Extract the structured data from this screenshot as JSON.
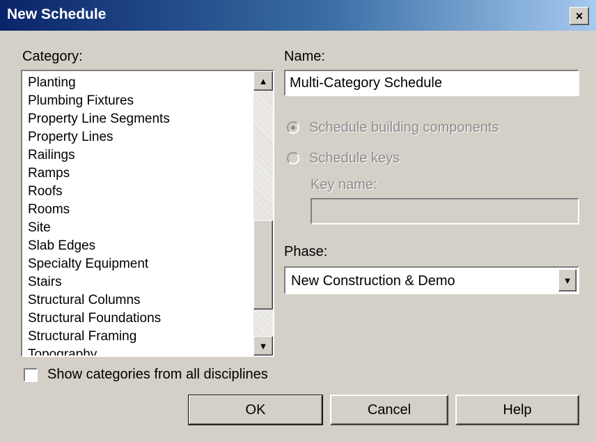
{
  "window": {
    "title": "New Schedule",
    "close_glyph": "×",
    "icon": "close-icon"
  },
  "category": {
    "label": "Category:",
    "items": [
      "Planting",
      "Plumbing Fixtures",
      "Property Line Segments",
      "Property Lines",
      "Railings",
      "Ramps",
      "Roofs",
      "Rooms",
      "Site",
      "Slab Edges",
      "Specialty Equipment",
      "Stairs",
      "Structural Columns",
      "Structural Foundations",
      "Structural Framing",
      "Topography"
    ],
    "scroll_up_glyph": "▲",
    "scroll_down_glyph": "▼"
  },
  "name": {
    "label": "Name:",
    "value": "Multi-Category Schedule"
  },
  "schedule_type": {
    "components_label": "Schedule building components",
    "keys_label": "Schedule keys",
    "key_name_label": "Key name:",
    "key_name_value": "",
    "selected": "components"
  },
  "phase": {
    "label": "Phase:",
    "value": "New Construction & Demo",
    "dropdown_glyph": "▼"
  },
  "show_all_disciplines": {
    "label": "Show categories from all disciplines",
    "checked": false
  },
  "buttons": {
    "ok": "OK",
    "cancel": "Cancel",
    "help": "Help"
  },
  "colors": {
    "dialog_bg": "#d4d0c8",
    "title_start": "#0a246a",
    "title_end": "#a6caf0",
    "disabled_text": "#8c8c8c"
  }
}
